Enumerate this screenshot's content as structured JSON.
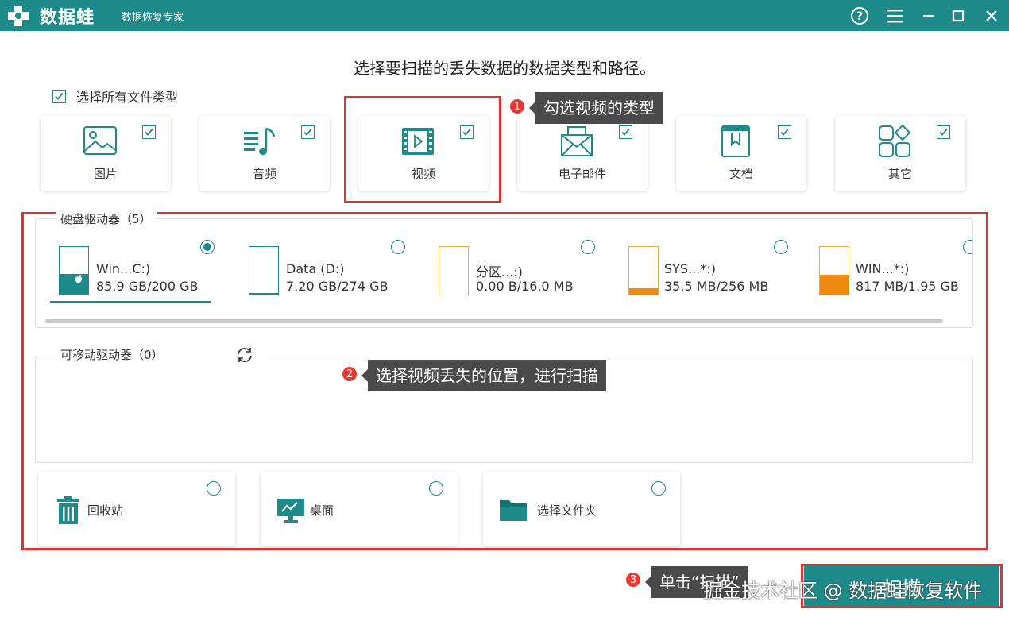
{
  "app": {
    "brand": "数据蛙",
    "subtitle": "数据恢复专家"
  },
  "heading": "选择要扫描的丢失数据的数据类型和路径。",
  "select_all_label": "选择所有文件类型",
  "file_types": [
    {
      "label": "图片",
      "icon": "image-icon",
      "checked": true
    },
    {
      "label": "音频",
      "icon": "audio-icon",
      "checked": true
    },
    {
      "label": "视频",
      "icon": "video-icon",
      "checked": true
    },
    {
      "label": "电子邮件",
      "icon": "email-icon",
      "checked": true
    },
    {
      "label": "文档",
      "icon": "document-icon",
      "checked": true
    },
    {
      "label": "其它",
      "icon": "other-icon",
      "checked": true
    }
  ],
  "hard_drives": {
    "legend": "硬盘驱动器（5）",
    "items": [
      {
        "name": "Win...C:)",
        "size": "85.9 GB/200 GB",
        "used_fraction": 0.43,
        "color": "#1e8a8a",
        "selected": true
      },
      {
        "name": "Data (D:)",
        "size": "7.20 GB/274 GB",
        "used_fraction": 0.03,
        "color": "#1e8a8a",
        "selected": false
      },
      {
        "name": "分区...:)",
        "size": "0.00  B/16.0 MB",
        "used_fraction": 0.0,
        "color": "#e0a020",
        "selected": false
      },
      {
        "name": "SYS...*:)",
        "size": "35.5 MB/256 MB",
        "used_fraction": 0.14,
        "color": "#ef8a10",
        "selected": false
      },
      {
        "name": "WIN...*:)",
        "size": "817 MB/1.95 GB",
        "used_fraction": 0.42,
        "color": "#ef8a10",
        "selected": false
      }
    ]
  },
  "removable_drives": {
    "legend": "可移动驱动器（0）"
  },
  "locations": [
    {
      "label": "回收站",
      "icon": "trash-icon"
    },
    {
      "label": "桌面",
      "icon": "desktop-icon"
    },
    {
      "label": "选择文件夹",
      "icon": "folder-icon"
    }
  ],
  "annotations": [
    {
      "num": "1",
      "text": "勾选视频的类型"
    },
    {
      "num": "2",
      "text": "选择视频丢失的位置，进行扫描"
    },
    {
      "num": "3",
      "text": "单击“扫描”"
    }
  ],
  "scan_button": "扫描",
  "watermark": "掘金技术社区 @ 数据蛙恢复软件",
  "colors": {
    "accent": "#1e8a8a",
    "annotation_red": "#e03434",
    "warning_orange": "#ef8a10"
  }
}
